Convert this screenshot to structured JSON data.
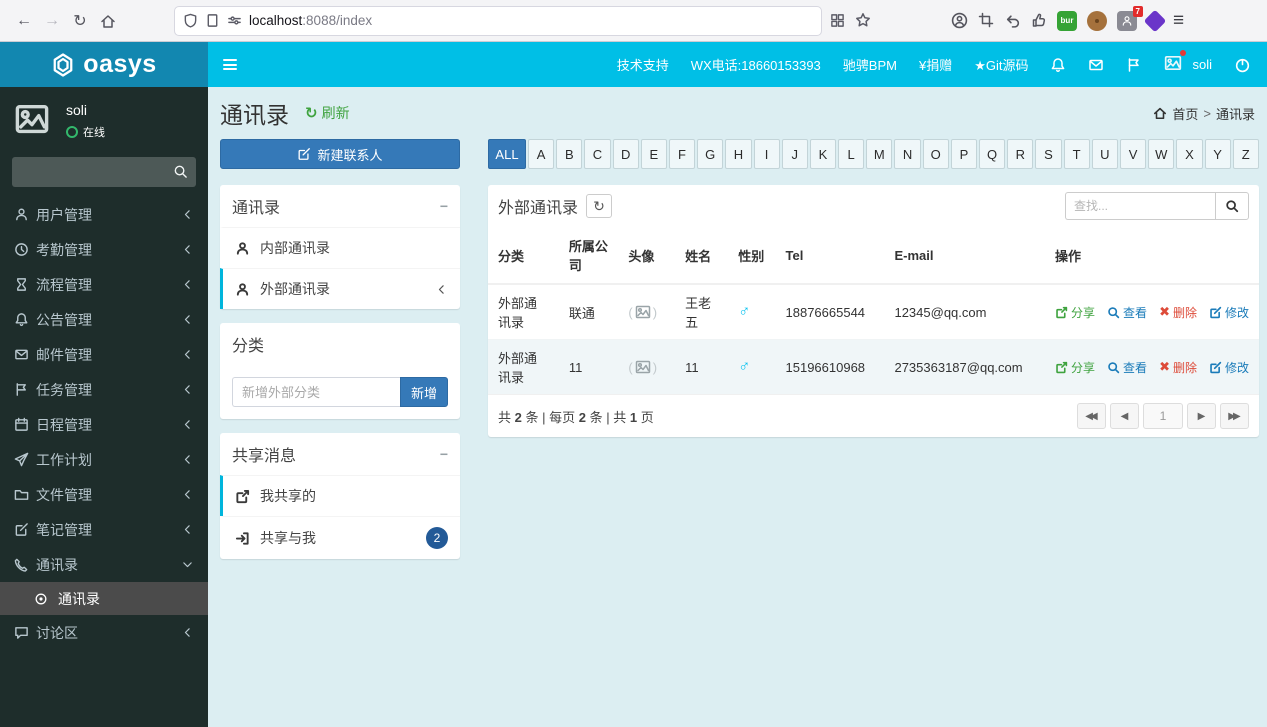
{
  "browser": {
    "url_host": "localhost",
    "url_path": ":8088/index",
    "ext_bur_label": "bur",
    "ext_badge_count": "7"
  },
  "navbar": {
    "logo": "oasys",
    "links": [
      "技术支持",
      "WX电话:18660153393",
      "驰骋BPM",
      "¥捐赠",
      "★Git源码"
    ],
    "username": "soli"
  },
  "sidebar": {
    "username": "soli",
    "status": "在线",
    "items": [
      {
        "label": "用户管理"
      },
      {
        "label": "考勤管理"
      },
      {
        "label": "流程管理"
      },
      {
        "label": "公告管理"
      },
      {
        "label": "邮件管理"
      },
      {
        "label": "任务管理"
      },
      {
        "label": "日程管理"
      },
      {
        "label": "工作计划"
      },
      {
        "label": "文件管理"
      },
      {
        "label": "笔记管理"
      },
      {
        "label": "通讯录"
      },
      {
        "label": "讨论区"
      }
    ],
    "submenu_item": "通讯录"
  },
  "content": {
    "page_title": "通讯录",
    "refresh_label": "刷新",
    "breadcrumb": {
      "home": "首页",
      "sep": ">",
      "current": "通讯录"
    },
    "new_contact_button": "新建联系人",
    "contacts_box": {
      "title": "通讯录",
      "internal": "内部通讯录",
      "external": "外部通讯录"
    },
    "category_box": {
      "title": "分类",
      "input_placeholder": "新增外部分类",
      "add_button": "新增"
    },
    "share_box": {
      "title": "共享消息",
      "shared_by_me": "我共享的",
      "shared_with_me": "共享与我",
      "badge": "2"
    },
    "alphabet": [
      "ALL",
      "A",
      "B",
      "C",
      "D",
      "E",
      "F",
      "G",
      "H",
      "I",
      "J",
      "K",
      "L",
      "M",
      "N",
      "O",
      "P",
      "Q",
      "R",
      "S",
      "T",
      "U",
      "V",
      "W",
      "X",
      "Y",
      "Z"
    ],
    "table": {
      "title": "外部通讯录",
      "search_placeholder": "查找...",
      "columns": [
        "分类",
        "所属公司",
        "头像",
        "姓名",
        "性别",
        "Tel",
        "E-mail",
        "操作"
      ],
      "rows": [
        {
          "category": "外部通讯录",
          "company": "联通",
          "name": "王老五",
          "gender": "♂",
          "tel": "18876665544",
          "email": "12345@qq.com"
        },
        {
          "category": "外部通讯录",
          "company": "11",
          "name": "11",
          "gender": "♂",
          "tel": "15196610968",
          "email": "2735363187@qq.com"
        }
      ],
      "actions": {
        "share": "分享",
        "view": "查看",
        "delete": "删除",
        "edit": "修改"
      },
      "footer": {
        "t1": "共",
        "total": "2",
        "t2": "条 | 每页",
        "per_page": "2",
        "t3": "条 | 共",
        "pages": "1",
        "t4": "页"
      },
      "page_input": "1"
    }
  },
  "colors": {
    "navbar": "#00bfe6",
    "logo_bg": "#1287b0",
    "primary_button": "#3579b8",
    "accent_border": "#00b5dc",
    "badge": "#235a97",
    "action_share": "#3fa33f",
    "action_view": "#1a7bb9",
    "action_delete": "#dd4b39",
    "male_symbol": "#00c0ef"
  }
}
